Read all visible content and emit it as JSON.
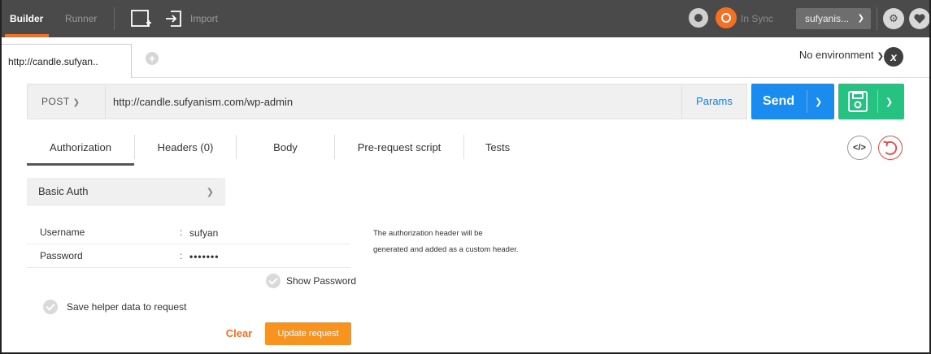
{
  "topbar": {
    "builder_label": "Builder",
    "runner_label": "Runner",
    "import_label": "Import",
    "sync_status": "In Sync",
    "user_label": "sufyanis...",
    "accent_color": "#f47023"
  },
  "tabs": {
    "active_tab_label": "http://candle.sufyan..",
    "environment_label": "No environment"
  },
  "request": {
    "method": "POST",
    "url": "http://candle.sufyanism.com/wp-admin",
    "params_label": "Params",
    "send_label": "Send",
    "send_color": "#1a8cf0",
    "save_color": "#26c281"
  },
  "subtabs": {
    "authorization": "Authorization",
    "headers": "Headers (0)",
    "body": "Body",
    "prerequest": "Pre-request script",
    "tests": "Tests"
  },
  "auth": {
    "type": "Basic Auth",
    "username_label": "Username",
    "username_value": "sufyan",
    "password_label": "Password",
    "password_value": "•••••••",
    "note_line1": "The authorization header will be",
    "note_line2": "generated and added as a custom header.",
    "show_password_label": "Show Password",
    "save_helper_label": "Save helper data to request",
    "clear_label": "Clear",
    "update_label": "Update request",
    "update_color": "#f7931e"
  }
}
